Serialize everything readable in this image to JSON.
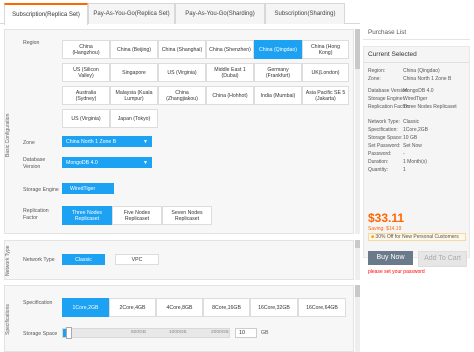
{
  "tabs": [
    {
      "label": "Subscription(Replica Set)"
    },
    {
      "label": "Pay-As-You-Go(Replica Set)"
    },
    {
      "label": "Pay-As-You-Go(Sharding)"
    },
    {
      "label": "Subscription(Sharding)"
    }
  ],
  "sections": {
    "basic": "Basic Configuration",
    "network": "Network Type",
    "specs": "Specifications"
  },
  "region": {
    "label": "Region",
    "options": [
      [
        "China (Hangzhou)",
        "China (Beijing)",
        "China (Shanghai)",
        "China (Shenzhen)",
        "China (Qingdao)",
        "China (Hong Kong)"
      ],
      [
        "US (Silicon Valley)",
        "Singapore",
        "US (Virginia)",
        "Middle East 1 (Dubai)",
        "Germany (Frankfurt)",
        "UK(London)"
      ],
      [
        "Australia (Sydney)",
        "Malaysia (Kuala Lumpur)",
        "China (Zhangjiakou)",
        "China (Hohhot)",
        "India (Mumbai)",
        "Asia Pacific SE 5 (Jakarta)"
      ],
      [
        "US (Virginia)",
        "Japan (Tokyo)"
      ]
    ]
  },
  "zone": {
    "label": "Zone",
    "value": "China North 1 Zone B"
  },
  "db_version": {
    "label": "Database Version",
    "value": "MongoDB 4.0"
  },
  "storage_engine": {
    "label": "Storage Engine",
    "value": "WiredTiger"
  },
  "replication": {
    "label": "Replication Factor",
    "options": [
      "Three Nodes Replicaset",
      "Five Nodes Replicaset",
      "Seven Nodes Replicaset"
    ]
  },
  "network": {
    "label": "Network Type",
    "options": [
      "Classic",
      "VPC"
    ]
  },
  "spec": {
    "label": "Specification",
    "options": [
      "1Core,2GB",
      "2Core,4GB",
      "4Core,8GB",
      "8Core,16GB",
      "16Core,32GB",
      "16Core,64GB"
    ]
  },
  "storage": {
    "label": "Storage Space",
    "ticks": [
      "500GB",
      "1000GB",
      "2000GB"
    ],
    "value": "10",
    "unit": "GB"
  },
  "summary": {
    "purchase_list": "Purchase List",
    "current_selected": "Current Selected",
    "rows": [
      {
        "k": "Region:",
        "v": "China (Qingdao)"
      },
      {
        "k": "Zone:",
        "v": "China North 1 Zone B"
      },
      {
        "k": "Database Version:",
        "v": "MongoDB 4.0"
      },
      {
        "k": "Storage Engine:",
        "v": "WiredTiger"
      },
      {
        "k": "Replication Factor:",
        "v": "Three Nodes Replicaset"
      },
      {
        "k": "Network Type:",
        "v": "Classic"
      },
      {
        "k": "Specification:",
        "v": "1Core,2GB"
      },
      {
        "k": "Storage Space:",
        "v": "10 GB"
      },
      {
        "k": "Set Password:",
        "v": "Set Now"
      },
      {
        "k": "Password:",
        "v": "-"
      },
      {
        "k": "Duration:",
        "v": "1 Month(s)"
      },
      {
        "k": "Quantity:",
        "v": "1"
      }
    ],
    "price": "$33.11",
    "saving": "Saving: $14.19",
    "promo": "30% Off for New Personal Customers",
    "buy_now": "Buy Now",
    "add_to_cart": "Add To Cart",
    "error": "please set your password"
  },
  "colors": {
    "accent": "#1da1f2",
    "price": "#ff6600",
    "buy": "#6b7a8a",
    "error": "#ff0000"
  }
}
